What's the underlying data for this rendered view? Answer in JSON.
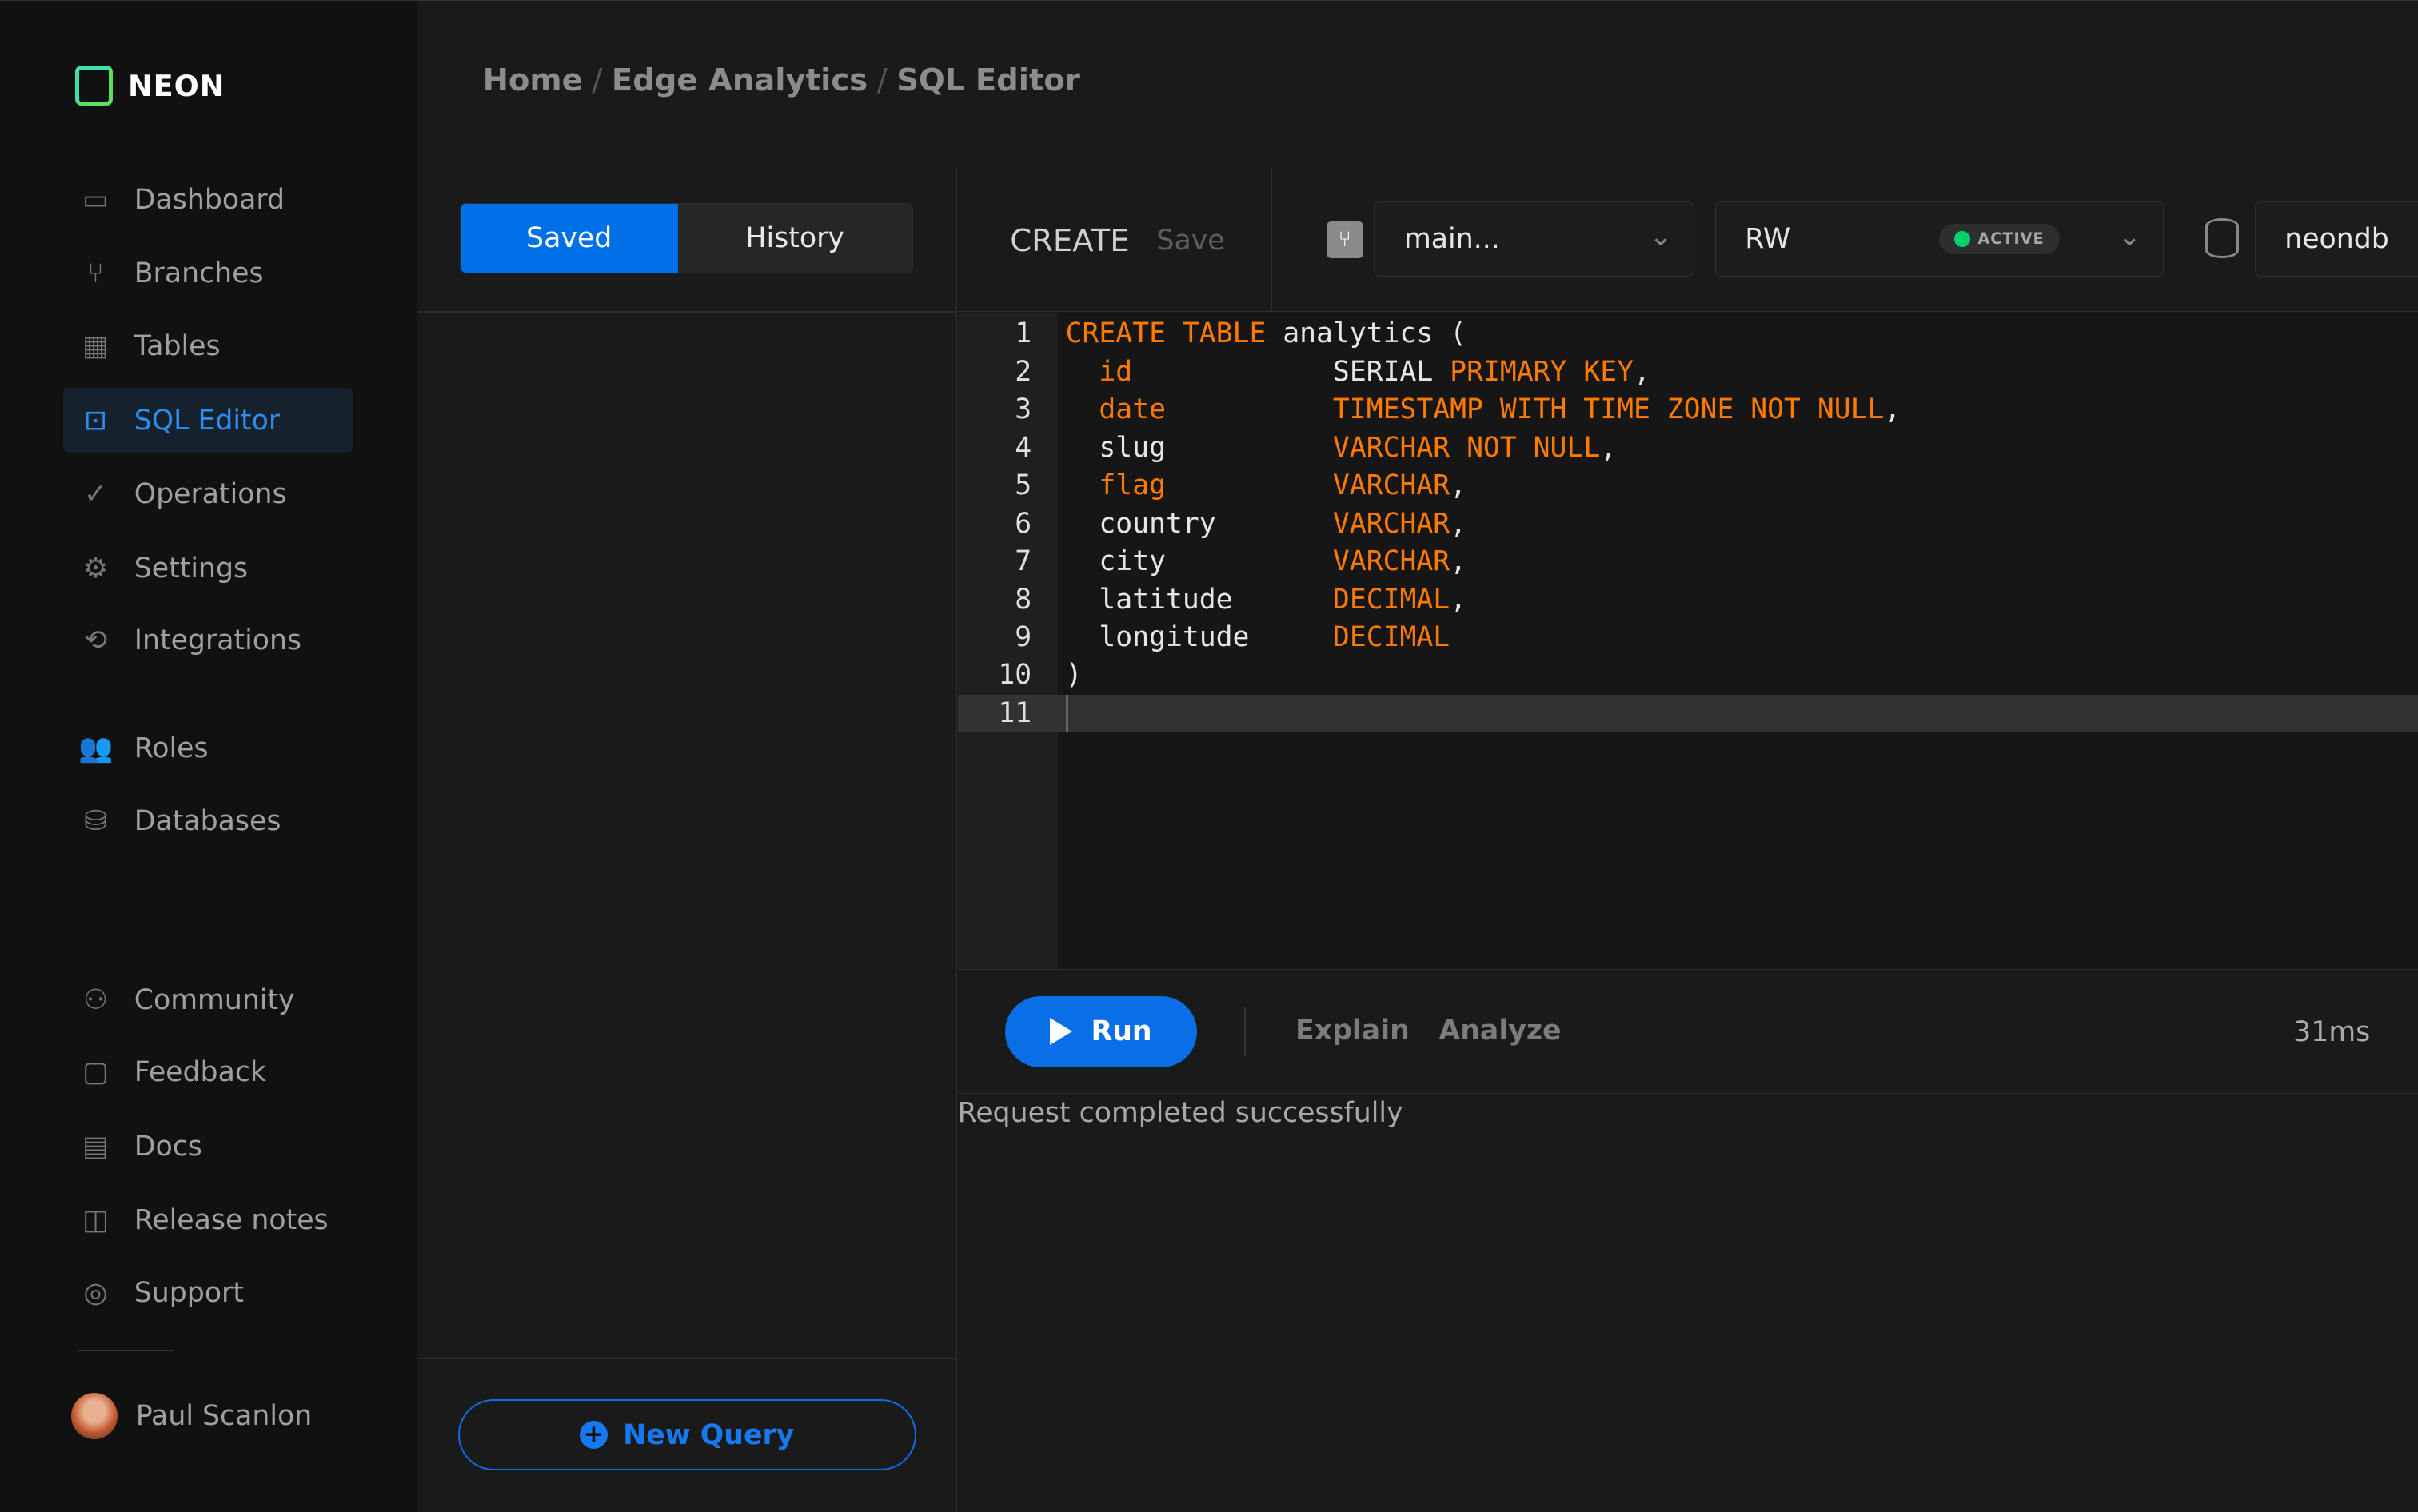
{
  "brand": {
    "name": "NEON",
    "colors": {
      "accent": "#0a6fe6",
      "keyword": "#ff7a00",
      "active_dot": "#00d26a"
    }
  },
  "sidebar": {
    "items": [
      {
        "label": "Dashboard",
        "icon": "dashboard-icon",
        "glyph": "▭"
      },
      {
        "label": "Branches",
        "icon": "branches-icon",
        "glyph": "⑂"
      },
      {
        "label": "Tables",
        "icon": "tables-icon",
        "glyph": "▦"
      },
      {
        "label": "SQL Editor",
        "icon": "sql-editor-icon",
        "glyph": "⊡",
        "active": true
      },
      {
        "label": "Operations",
        "icon": "operations-icon",
        "glyph": "✓"
      },
      {
        "label": "Settings",
        "icon": "settings-icon",
        "glyph": "⚙"
      },
      {
        "label": "Integrations",
        "icon": "integrations-icon",
        "glyph": "⟲"
      },
      {
        "label": "Roles",
        "icon": "roles-icon",
        "glyph": "👥"
      },
      {
        "label": "Databases",
        "icon": "database-icon",
        "glyph": "⛁"
      },
      {
        "label": "Community",
        "icon": "community-icon",
        "glyph": "⚇"
      },
      {
        "label": "Feedback",
        "icon": "feedback-icon",
        "glyph": "▢"
      },
      {
        "label": "Docs",
        "icon": "docs-icon",
        "glyph": "▤"
      },
      {
        "label": "Release notes",
        "icon": "release-notes-icon",
        "glyph": "◫"
      },
      {
        "label": "Support",
        "icon": "support-icon",
        "glyph": "◎"
      }
    ],
    "user": {
      "name": "Paul Scanlon"
    }
  },
  "breadcrumb": [
    "Home",
    "Edge Analytics",
    "SQL Editor"
  ],
  "breadcrumb_sep": "/",
  "left_panel": {
    "tabs": [
      "Saved",
      "History"
    ],
    "active_tab": "Saved",
    "new_query_label": "New Query"
  },
  "toolbar": {
    "create_label": "CREATE",
    "save_label": "Save",
    "branch": "main...",
    "compute": "RW",
    "compute_status": "ACTIVE",
    "database": "neondb"
  },
  "editor": {
    "lines": [
      [
        [
          "kw",
          "CREATE TABLE"
        ],
        [
          "id",
          " analytics ("
        ]
      ],
      [
        [
          "kw",
          "  id"
        ],
        [
          "id",
          "            SERIAL "
        ],
        [
          "kw",
          "PRIMARY KEY"
        ],
        [
          "id",
          ","
        ]
      ],
      [
        [
          "kw",
          "  date"
        ],
        [
          "kw",
          "          TIMESTAMP WITH TIME ZONE NOT NULL"
        ],
        [
          "id",
          ","
        ]
      ],
      [
        [
          "id",
          "  slug          "
        ],
        [
          "kw",
          "VARCHAR NOT NULL"
        ],
        [
          "id",
          ","
        ]
      ],
      [
        [
          "kw",
          "  flag          VARCHAR"
        ],
        [
          "id",
          ","
        ]
      ],
      [
        [
          "id",
          "  country       "
        ],
        [
          "kw",
          "VARCHAR"
        ],
        [
          "id",
          ","
        ]
      ],
      [
        [
          "id",
          "  city          "
        ],
        [
          "kw",
          "VARCHAR"
        ],
        [
          "id",
          ","
        ]
      ],
      [
        [
          "id",
          "  latitude      "
        ],
        [
          "kw",
          "DECIMAL"
        ],
        [
          "id",
          ","
        ]
      ],
      [
        [
          "id",
          "  longitude     "
        ],
        [
          "kw",
          "DECIMAL"
        ]
      ],
      [
        [
          "id",
          ")"
        ]
      ],
      []
    ],
    "current_line": 11
  },
  "runbar": {
    "run_label": "Run",
    "explain_label": "Explain",
    "analyze_label": "Analyze",
    "duration": "31ms"
  },
  "status_message": "Request completed successfully"
}
